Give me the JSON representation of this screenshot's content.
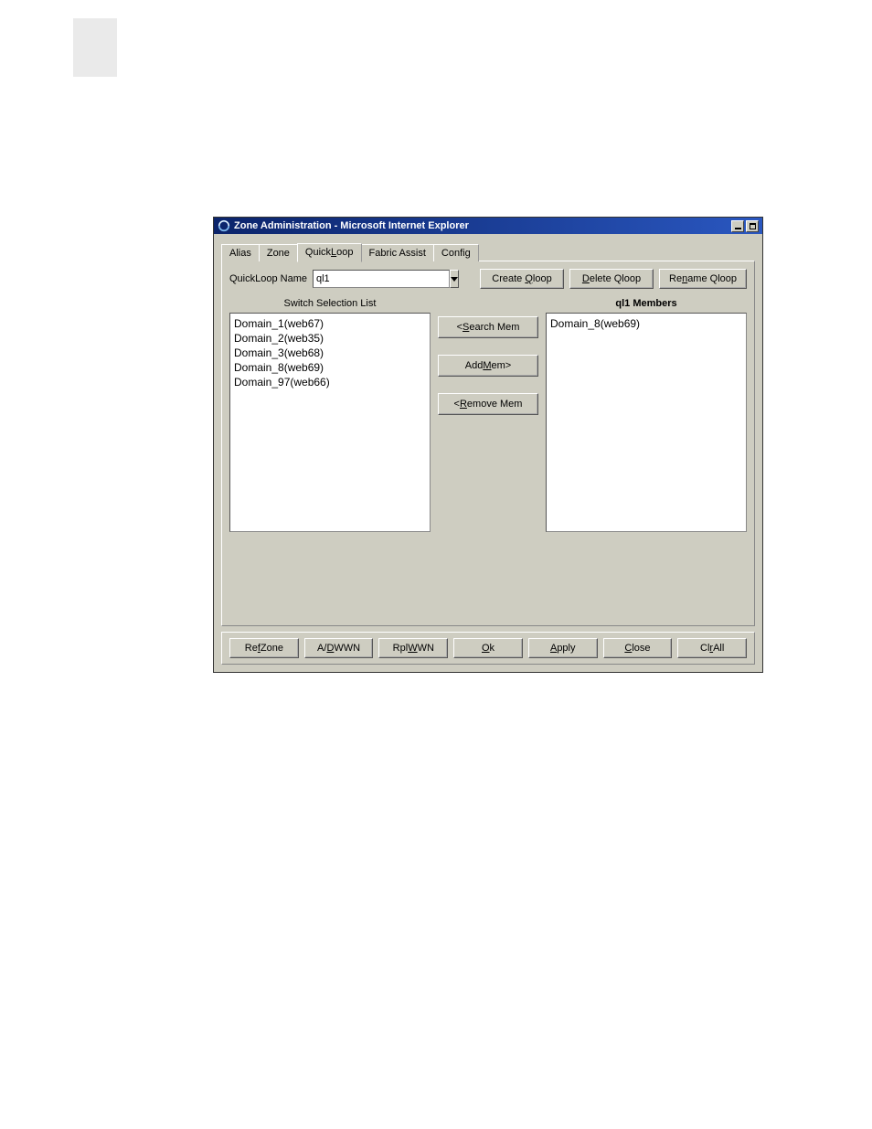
{
  "window": {
    "title": "Zone Administration - Microsoft Internet Explorer"
  },
  "tabs": {
    "alias": "Alias",
    "zone": "Zone",
    "quickloop_pre": "Quick",
    "quickloop_u": "L",
    "quickloop_post": "oop",
    "fabric_assist": "Fabric Assist",
    "config": "Config"
  },
  "panel": {
    "name_label": "QuickLoop Name",
    "name_value": "ql1",
    "create_btn": "Create Qloop",
    "create_u": "Q",
    "delete_btn": "elete Qloop",
    "delete_u": "D",
    "rename_pre": "Re",
    "rename_u": "n",
    "rename_post": "ame Qloop",
    "left_header": "Switch Selection List",
    "right_header": "ql1 Members",
    "search_pre": "<",
    "search_u": "S",
    "search_post": "earch Mem",
    "add_pre": "Add ",
    "add_u": "M",
    "add_post": "em>",
    "remove_pre": "<",
    "remove_u": "R",
    "remove_post": "emove Mem",
    "left_list": [
      "Domain_1(web67)",
      "Domain_2(web35)",
      "Domain_3(web68)",
      "Domain_8(web69)",
      "Domain_97(web66)"
    ],
    "right_list": [
      "Domain_8(web69)"
    ]
  },
  "bottom": {
    "ref_pre": "Re",
    "ref_u": "f",
    "ref_post": " Zone",
    "ad_pre": "A/",
    "ad_u": "D",
    "ad_post": " WWN",
    "rpl_pre": "Rpl ",
    "rpl_u": "W",
    "rpl_post": "WN",
    "ok_u": "O",
    "ok_post": "k",
    "apply_u": "A",
    "apply_post": "pply",
    "close_u": "C",
    "close_post": "lose",
    "clr_pre": "Cl",
    "clr_u": "r",
    "clr_post": " All"
  }
}
